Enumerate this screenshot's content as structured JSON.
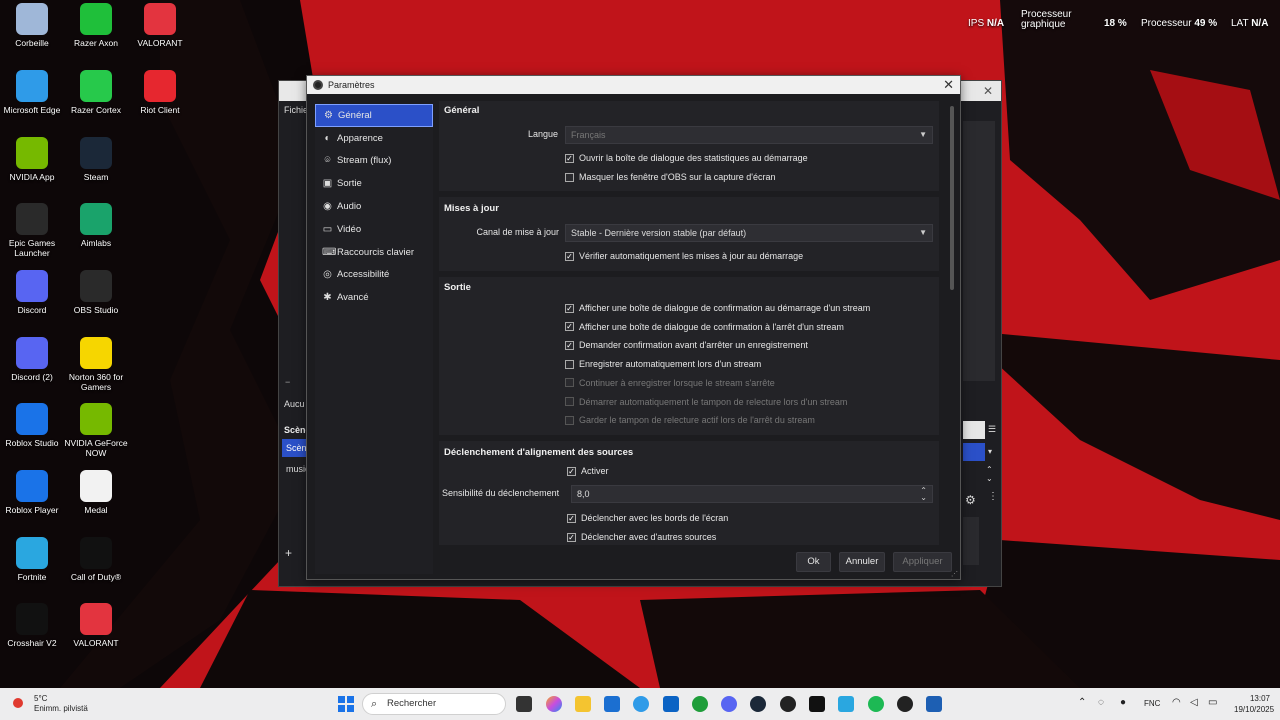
{
  "overlay": {
    "ips_label": "IPS",
    "ips_value": "N/A",
    "gpu_label_1": "Processeur",
    "gpu_label_2": "graphique",
    "gpu_value": "18 %",
    "cpu_label": "Processeur",
    "cpu_value": "49 %",
    "lat_label": "LAT",
    "lat_value": "N/A"
  },
  "desktop_icons": [
    {
      "label": "Corbeille",
      "icon": "recycle-bin-icon"
    },
    {
      "label": "Razer Axon",
      "icon": "razer-axon-icon"
    },
    {
      "label": "VALORANT",
      "icon": "valorant-icon"
    },
    {
      "label": "Microsoft Edge",
      "icon": "edge-icon"
    },
    {
      "label": "Razer Cortex",
      "icon": "razer-cortex-icon"
    },
    {
      "label": "Riot Client",
      "icon": "riot-client-icon"
    },
    {
      "label": "NVIDIA App",
      "icon": "nvidia-icon"
    },
    {
      "label": "Steam",
      "icon": "steam-icon"
    },
    {
      "label": "Epic Games Launcher",
      "icon": "epic-games-icon"
    },
    {
      "label": "Aimlabs",
      "icon": "aimlabs-icon"
    },
    {
      "label": "Discord",
      "icon": "discord-icon"
    },
    {
      "label": "OBS Studio",
      "icon": "obs-icon"
    },
    {
      "label": "Discord (2)",
      "icon": "discord-icon"
    },
    {
      "label": "Norton 360 for Gamers",
      "icon": "norton-icon"
    },
    {
      "label": "Roblox Studio",
      "icon": "roblox-studio-icon"
    },
    {
      "label": "NVIDIA GeForce NOW",
      "icon": "geforce-now-icon"
    },
    {
      "label": "Roblox Player",
      "icon": "roblox-icon"
    },
    {
      "label": "Medal",
      "icon": "file-icon"
    },
    {
      "label": "Fortnite",
      "icon": "fortnite-icon"
    },
    {
      "label": "Call of Duty®",
      "icon": "call-of-duty-icon"
    },
    {
      "label": "Crosshair V2",
      "icon": "crosshair-icon"
    },
    {
      "label": "VALORANT",
      "icon": "valorant-icon"
    }
  ],
  "obs_main": {
    "menu_fichier": "Fichie",
    "label_aucun": "Aucu",
    "scenes_title": "Scène",
    "scene_item": "Scène",
    "source_item": "music"
  },
  "settings": {
    "window_title": "Paramètres",
    "nav": [
      {
        "label": "Général",
        "icon": "gear-icon",
        "active": true
      },
      {
        "label": "Apparence",
        "icon": "palette-icon"
      },
      {
        "label": "Stream (flux)",
        "icon": "broadcast-icon"
      },
      {
        "label": "Sortie",
        "icon": "output-icon"
      },
      {
        "label": "Audio",
        "icon": "speaker-icon"
      },
      {
        "label": "Vidéo",
        "icon": "monitor-icon"
      },
      {
        "label": "Raccourcis clavier",
        "icon": "keyboard-icon"
      },
      {
        "label": "Accessibilité",
        "icon": "accessibility-icon"
      },
      {
        "label": "Avancé",
        "icon": "wrench-icon"
      }
    ],
    "general": {
      "title": "Général",
      "language_label": "Langue",
      "language_value": "Français",
      "check_stats": "Ouvrir la boîte de dialogue des statistiques au démarrage",
      "check_hide": "Masquer les fenêtre d'OBS sur la capture d'écran"
    },
    "updates": {
      "title": "Mises à jour",
      "channel_label": "Canal de mise à jour",
      "channel_value": "Stable - Dernière version stable (par défaut)",
      "check_auto": "Vérifier automatiquement les mises à jour au démarrage"
    },
    "output": {
      "title": "Sortie",
      "items": [
        {
          "label": "Afficher une boîte de dialogue de confirmation au démarrage d'un stream",
          "checked": true,
          "disabled": false
        },
        {
          "label": "Afficher une boîte de dialogue de confirmation à l'arrêt d'un stream",
          "checked": true,
          "disabled": false
        },
        {
          "label": "Demander confirmation avant d'arrêter un enregistrement",
          "checked": true,
          "disabled": false
        },
        {
          "label": "Enregistrer automatiquement lors d'un stream",
          "checked": false,
          "disabled": false
        },
        {
          "label": "Continuer à enregistrer lorsque le stream s'arrête",
          "checked": false,
          "disabled": true
        },
        {
          "label": "Démarrer automatiquement le tampon de relecture lors d'un stream",
          "checked": false,
          "disabled": true
        },
        {
          "label": "Garder le tampon de relecture actif lors de l'arrêt du stream",
          "checked": false,
          "disabled": true
        }
      ]
    },
    "snapping": {
      "title": "Déclenchement d'alignement des sources",
      "enable": "Activer",
      "sensitivity_label": "Sensibilité du déclenchement",
      "sensitivity_value": "8,0",
      "screen_edges": "Déclencher avec les bords de l'écran",
      "other_sources": "Déclencher avec d'autres sources"
    },
    "buttons": {
      "ok": "Ok",
      "cancel": "Annuler",
      "apply": "Appliquer"
    }
  },
  "taskbar": {
    "weather_temp": "5°C",
    "weather_desc": "Enimm. pilvistä",
    "search_placeholder": "Rechercher",
    "lang": "FNC",
    "time": "13:07",
    "date": "19/10/2025"
  }
}
